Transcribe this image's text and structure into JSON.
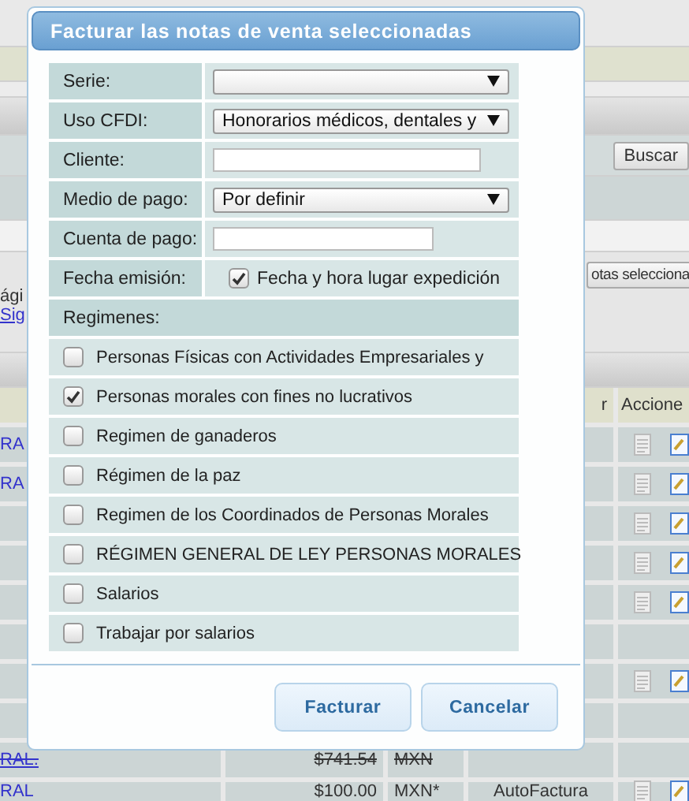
{
  "background": {
    "search_button": "Buscar",
    "bulk_button": "otas selecciona",
    "pager_text": "ági",
    "pager_link": "Sig",
    "table": {
      "columns": [
        "r",
        "Accione"
      ],
      "rows": [
        {
          "column_1": "RA",
          "actions": true,
          "cancelled": false
        },
        {
          "column_1": "RA",
          "actions": true,
          "cancelled": false
        },
        {
          "actions": true
        },
        {
          "actions": true
        },
        {
          "actions": true
        },
        {
          "actions": false
        },
        {
          "actions": true
        },
        {
          "actions": false
        },
        {
          "column_1": "RAL.",
          "amount": "$741.54",
          "currency": "MXN",
          "actions": false,
          "cancelled": true
        },
        {
          "column_1": "RAL",
          "amount": "$100.00",
          "currency": "MXN*",
          "column_4": "AutoFactura",
          "actions": true,
          "cancelled": false
        }
      ]
    }
  },
  "dialog": {
    "title": "Facturar las notas de venta seleccionadas",
    "fields": [
      {
        "kind": "select",
        "label": "Serie:"
      },
      {
        "kind": "select",
        "label": "Uso CFDI:",
        "value": "Honorarios médicos, dentales y"
      },
      {
        "kind": "text",
        "label": "Cliente:"
      },
      {
        "kind": "select",
        "label": "Medio de pago:",
        "value": "Por definir"
      },
      {
        "kind": "text",
        "label": "Cuenta de pago:"
      },
      {
        "kind": "checkbox",
        "label": "Fecha emisión:",
        "value": "Fecha y hora lugar expedición",
        "checked": true
      }
    ],
    "regimes_label": "Regimenes:",
    "regimes": [
      {
        "label": "Personas Físicas con Actividades Empresariales y",
        "checked": false
      },
      {
        "label": "Personas morales con fines no lucrativos",
        "checked": true
      },
      {
        "label": "Regimen de ganaderos",
        "checked": false
      },
      {
        "label": "Régimen de la paz",
        "checked": false
      },
      {
        "label": "Regimen de los Coordinados de Personas Morales",
        "checked": false
      },
      {
        "label": "RÉGIMEN GENERAL DE LEY PERSONAS MORALES",
        "checked": false
      },
      {
        "label": "Salarios",
        "checked": false
      },
      {
        "label": "Trabajar por salarios",
        "checked": false
      }
    ],
    "buttons": [
      "Facturar",
      "Cancelar"
    ]
  }
}
